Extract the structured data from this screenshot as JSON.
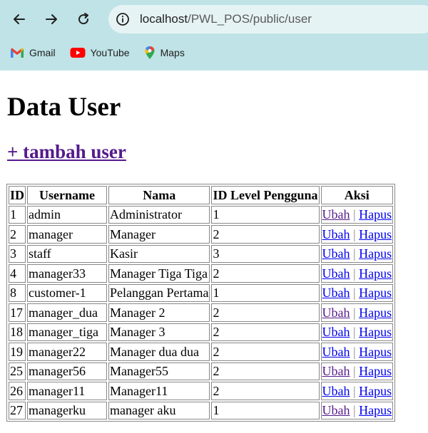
{
  "browser": {
    "url_host": "localhost",
    "url_path": "/PWL_POS/public/user",
    "bookmarks": [
      {
        "label": "Gmail",
        "icon": "gmail-icon"
      },
      {
        "label": "YouTube",
        "icon": "youtube-icon"
      },
      {
        "label": "Maps",
        "icon": "maps-icon"
      }
    ]
  },
  "page": {
    "title": "Data User",
    "add_link": "+ tambah user"
  },
  "table": {
    "headers": [
      "ID",
      "Username",
      "Nama",
      "ID Level Pengguna",
      "Aksi"
    ],
    "edit_label": "Ubah",
    "separator": "|",
    "delete_label": "Hapus",
    "rows": [
      {
        "id": "1",
        "username": "admin",
        "nama": "Administrator",
        "level": "1",
        "edit_visited": true
      },
      {
        "id": "2",
        "username": "manager",
        "nama": "Manager",
        "level": "2",
        "edit_visited": false
      },
      {
        "id": "3",
        "username": "staff",
        "nama": "Kasir",
        "level": "3",
        "edit_visited": false
      },
      {
        "id": "4",
        "username": "manager33",
        "nama": "Manager Tiga Tiga",
        "level": "2",
        "edit_visited": false
      },
      {
        "id": "8",
        "username": "customer-1",
        "nama": "Pelanggan Pertama",
        "level": "1",
        "edit_visited": false
      },
      {
        "id": "17",
        "username": "manager_dua",
        "nama": "Manager 2",
        "level": "2",
        "edit_visited": true
      },
      {
        "id": "18",
        "username": "manager_tiga",
        "nama": "Manager 3",
        "level": "2",
        "edit_visited": false
      },
      {
        "id": "19",
        "username": "manager22",
        "nama": "Manager dua dua",
        "level": "2",
        "edit_visited": false
      },
      {
        "id": "25",
        "username": "manager56",
        "nama": "Manager55",
        "level": "2",
        "edit_visited": true
      },
      {
        "id": "26",
        "username": "manager11",
        "nama": "Manager11",
        "level": "2",
        "edit_visited": false
      },
      {
        "id": "27",
        "username": "managerku",
        "nama": "manager aku",
        "level": "1",
        "edit_visited": true
      }
    ]
  },
  "colors": {
    "chrome_bg": "#bfe3e6",
    "link": "#0000ee",
    "visited": "#551a8b"
  }
}
